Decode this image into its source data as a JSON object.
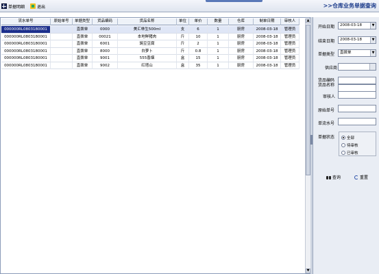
{
  "toolbar": {
    "detail_label": "单据明细",
    "exit_label": "退出",
    "page_heading": ">>仓库业务单据查询"
  },
  "grid": {
    "columns": [
      "流水单号",
      "原始单号",
      "单据类型",
      "货品编码",
      "货品名称",
      "单位",
      "单价",
      "数量",
      "仓库",
      "制单日期",
      "审核人"
    ],
    "rows": [
      [
        "000000RL0803180001",
        "",
        "直拨单",
        "0000",
        "美汇林生500ml",
        "支",
        "6",
        "1",
        "厨房",
        "2008-03-18",
        "管理员"
      ],
      [
        "000000RL0803180001",
        "",
        "直拨单",
        "00021",
        "本地鲜猪肉",
        "斤",
        "10",
        "1",
        "厨房",
        "2008-03-18",
        "管理员"
      ],
      [
        "000000RL0803180001",
        "",
        "直拨单",
        "6001",
        "豌豆豆腐",
        "斤",
        "2",
        "1",
        "厨房",
        "2008-03-18",
        "管理员"
      ],
      [
        "000000RL0803180001",
        "",
        "直拨单",
        "8000",
        "白萝卜",
        "斤",
        "0.8",
        "1",
        "厨房",
        "2008-03-18",
        "管理员"
      ],
      [
        "000000RL0803180001",
        "",
        "直拨单",
        "9001",
        "555香烟",
        "盒",
        "15",
        "1",
        "厨房",
        "2008-03-18",
        "管理员"
      ],
      [
        "000000RL0803180001",
        "",
        "直拨单",
        "9002",
        "红塔山",
        "盒",
        "35",
        "1",
        "厨房",
        "2008-03-18",
        "管理员"
      ]
    ]
  },
  "filters": {
    "start_date_label": "开始日期",
    "start_date_value": "2008-03-18",
    "end_date_label": "结束日期",
    "end_date_value": "2008-03-18",
    "doc_type_label": "单据类型",
    "doc_type_value": "直拨单",
    "supplier_label": "供应商",
    "supplier_value": "",
    "item_code_label": "货品编码",
    "item_name_label": "货品名称",
    "item_code_value": "",
    "item_name_value": "",
    "auditor_label": "审核人",
    "auditor_value": "",
    "orig_no_label": "原始单号",
    "orig_no_value": "",
    "serial_no_label": "单流水号",
    "serial_no_value": "",
    "status_label": "单据状态",
    "status_options": [
      "全部",
      "待审核",
      "已审核"
    ],
    "status_selected": "全部"
  },
  "actions": {
    "query_label": "查询",
    "reset_label": "重置"
  },
  "colors": {
    "heading": "#1a3a8a",
    "selection": "#1c2f8c"
  }
}
